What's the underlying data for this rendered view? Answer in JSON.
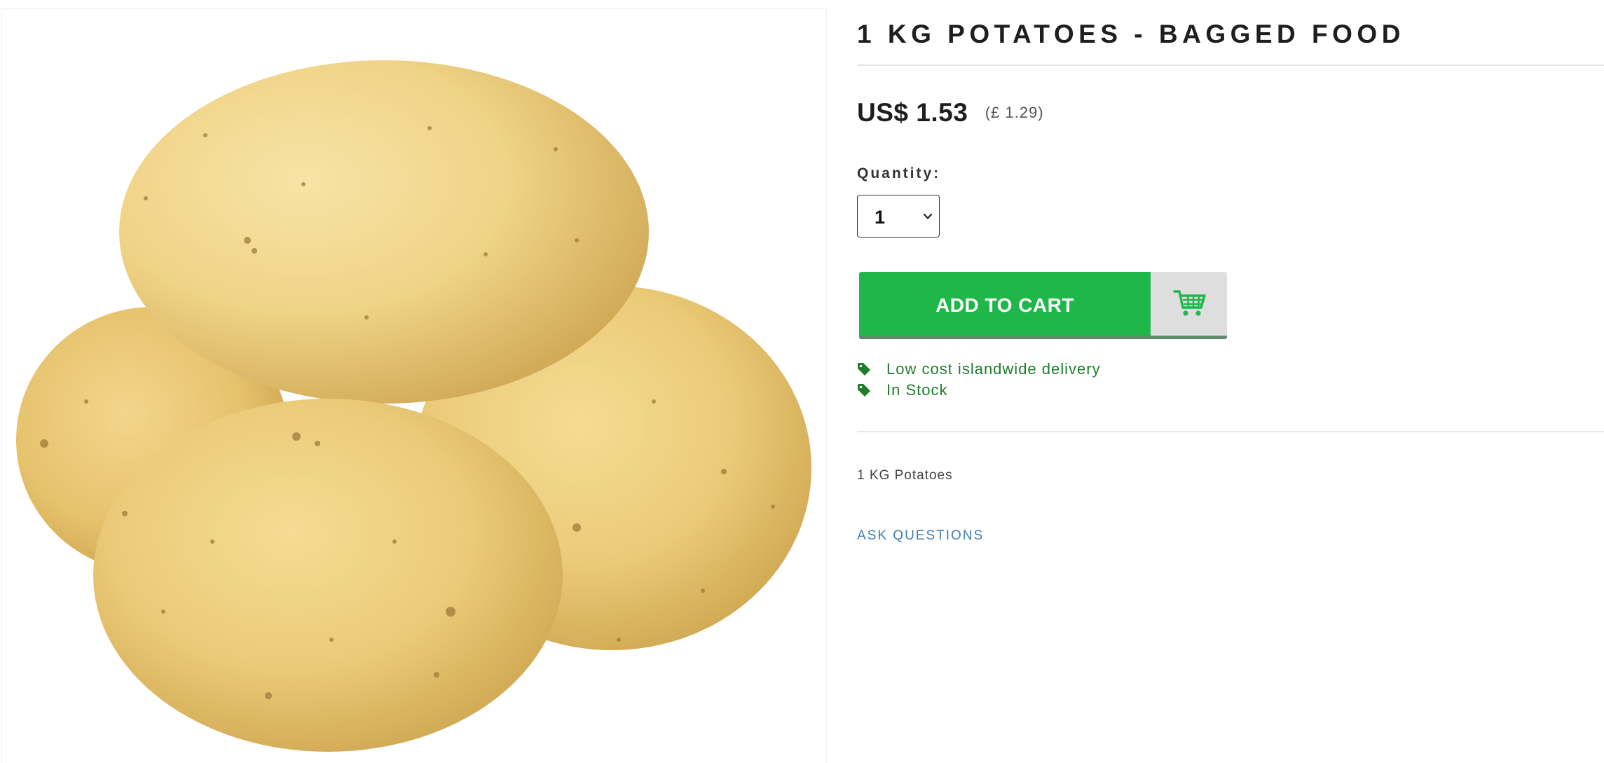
{
  "product": {
    "title": "1 KG POTATOES - BAGGED FOOD",
    "image_alt": "potatoes",
    "price_main": "US$ 1.53",
    "price_alt": "(£ 1.29)",
    "description": "1 KG Potatoes"
  },
  "quantity": {
    "label": "Quantity:",
    "selected": "1"
  },
  "cart": {
    "button_label": "ADD TO CART",
    "icon": "shopping-cart-icon"
  },
  "features": [
    {
      "icon": "tag-icon",
      "text": "Low cost islandwide delivery"
    },
    {
      "icon": "tag-icon",
      "text": "In Stock"
    }
  ],
  "links": {
    "ask_questions": "ASK QUESTIONS"
  },
  "colors": {
    "accent_green": "#1fb74a",
    "feature_green": "#1e7d2b",
    "link_blue": "#3f7fb0",
    "icon_box_gray": "#dedede"
  }
}
